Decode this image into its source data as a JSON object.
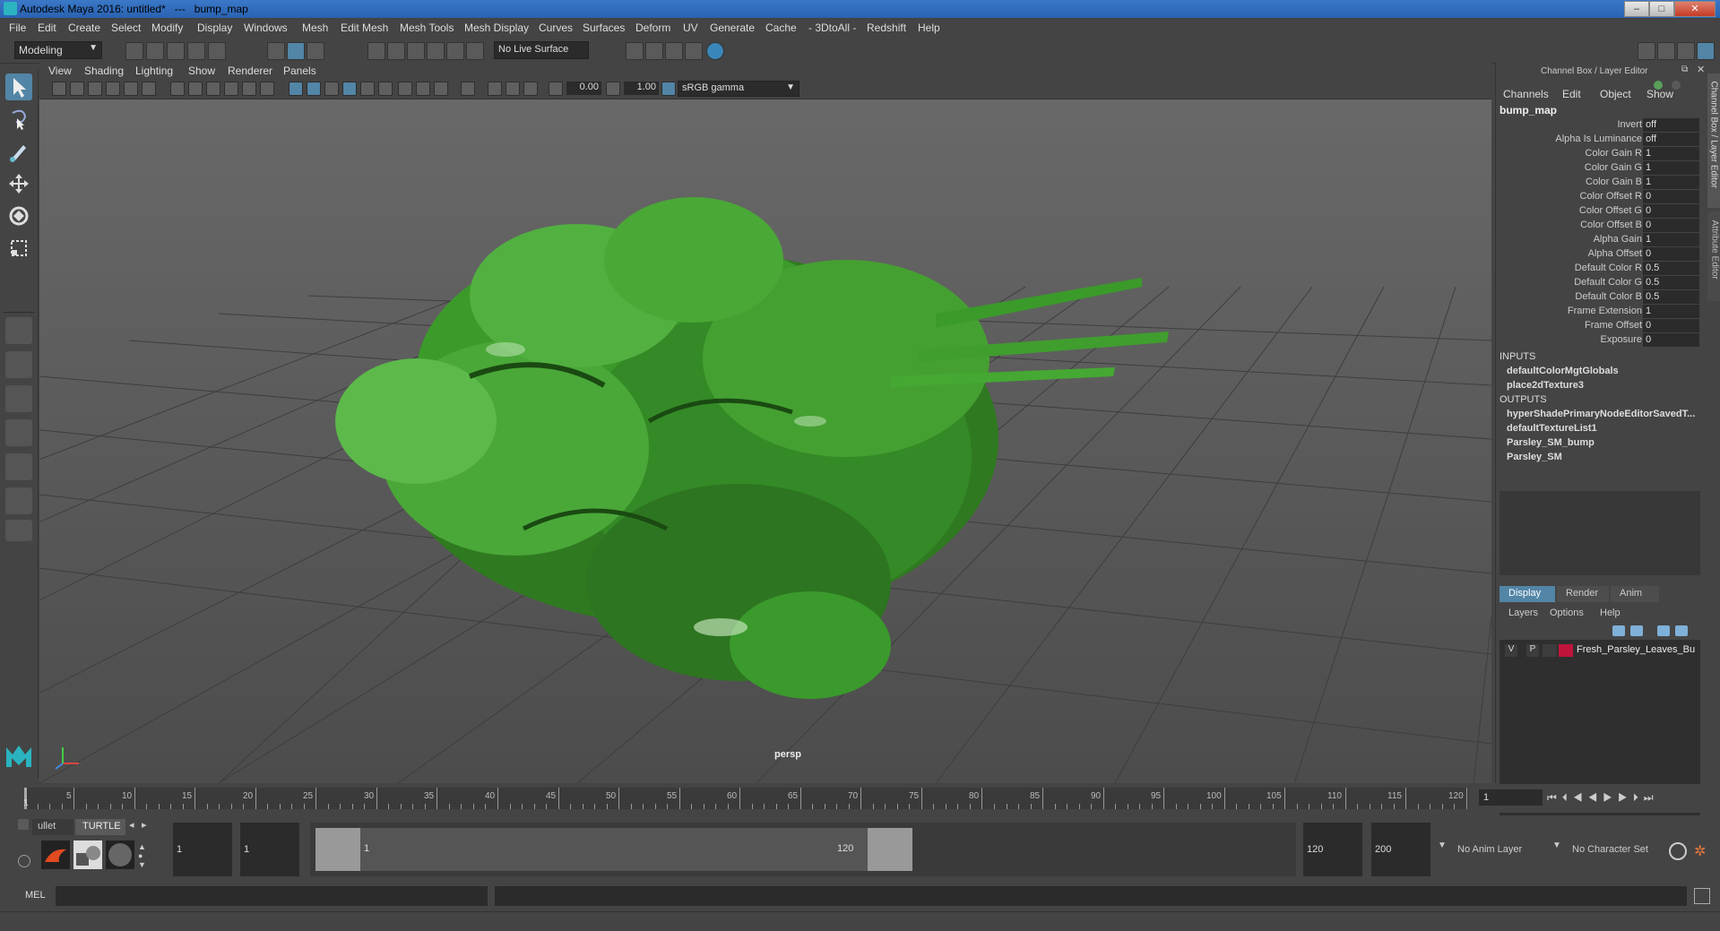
{
  "window": {
    "title": "Autodesk Maya 2016: untitled*   ---   bump_map",
    "minimize": "–",
    "maximize": "□",
    "close": "✕"
  },
  "menus": [
    "File",
    "Edit",
    "Create",
    "Select",
    "Modify",
    "Display",
    "Windows",
    "Mesh",
    "Edit Mesh",
    "Mesh Tools",
    "Mesh Display",
    "Curves",
    "Surfaces",
    "Deform",
    "UV",
    "Generate",
    "Cache",
    "- 3DtoAll -",
    "Redshift",
    "Help"
  ],
  "status": {
    "mode": "Modeling",
    "live_surface": "No Live Surface"
  },
  "panel": {
    "menus": [
      "View",
      "Shading",
      "Lighting",
      "Show",
      "Renderer",
      "Panels"
    ],
    "near_value": "0.00",
    "far_value": "1.00",
    "color_space": "sRGB gamma",
    "camera_label": "persp"
  },
  "channel_box": {
    "title": "Channel Box / Layer Editor",
    "side_tab_1": "Channel Box / Layer Editor",
    "side_tab_2": "Attribute Editor",
    "menus": [
      "Channels",
      "Edit",
      "Object",
      "Show"
    ],
    "node_name": "bump_map",
    "attributes": [
      {
        "name": "Invert",
        "value": "off"
      },
      {
        "name": "Alpha Is Luminance",
        "value": "off"
      },
      {
        "name": "Color Gain R",
        "value": "1"
      },
      {
        "name": "Color Gain G",
        "value": "1"
      },
      {
        "name": "Color Gain B",
        "value": "1"
      },
      {
        "name": "Color Offset R",
        "value": "0"
      },
      {
        "name": "Color Offset G",
        "value": "0"
      },
      {
        "name": "Color Offset B",
        "value": "0"
      },
      {
        "name": "Alpha Gain",
        "value": "1"
      },
      {
        "name": "Alpha Offset",
        "value": "0"
      },
      {
        "name": "Default Color R",
        "value": "0.5"
      },
      {
        "name": "Default Color G",
        "value": "0.5"
      },
      {
        "name": "Default Color B",
        "value": "0.5"
      },
      {
        "name": "Frame Extension",
        "value": "1"
      },
      {
        "name": "Frame Offset",
        "value": "0"
      },
      {
        "name": "Exposure",
        "value": "0"
      }
    ],
    "inputs_label": "INPUTS",
    "inputs": [
      "defaultColorMgtGlobals",
      "place2dTexture3"
    ],
    "outputs_label": "OUTPUTS",
    "outputs": [
      "hyperShadePrimaryNodeEditorSavedT...",
      "defaultTextureList1",
      "Parsley_SM_bump",
      "Parsley_SM"
    ]
  },
  "layer_editor": {
    "tabs": [
      "Display",
      "Render",
      "Anim"
    ],
    "menus": [
      "Layers",
      "Options",
      "Help"
    ],
    "layer": {
      "v": "V",
      "p": "P",
      "name": "Fresh_Parsley_Leaves_Bu",
      "color": "#c0143c"
    }
  },
  "timeline": {
    "ticks": [
      "5",
      "10",
      "15",
      "20",
      "25",
      "30",
      "35",
      "40",
      "45",
      "50",
      "55",
      "60",
      "65",
      "70",
      "75",
      "80",
      "85",
      "90",
      "95",
      "100",
      "105",
      "110",
      "115",
      "120"
    ],
    "start_marker": "1",
    "current_frame": "1"
  },
  "range": {
    "shelf_tabs": [
      "ullet",
      "TURTLE"
    ],
    "start_time": "1",
    "playback_start": "1",
    "range_start_label": "1",
    "range_end_label": "120",
    "playback_end": "120",
    "end_time": "200",
    "anim_layer": "No Anim Layer",
    "character_set": "No Character Set"
  },
  "command": {
    "mel_label": "MEL"
  },
  "colors": {
    "accent": "#5285a6",
    "parsley": "#3aa028"
  }
}
